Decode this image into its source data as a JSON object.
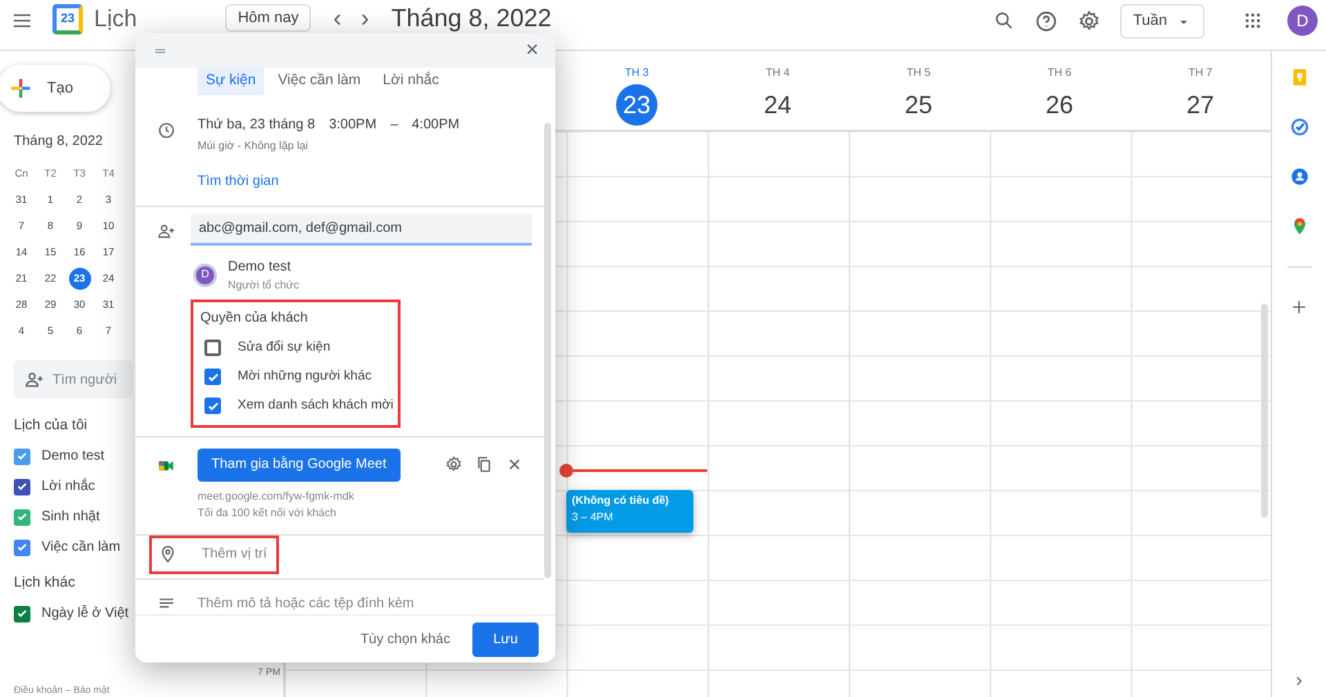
{
  "header": {
    "app_name": "Lịch",
    "logo_text": "23",
    "today_button": "Hôm nay",
    "prev": "‹",
    "next": "›",
    "title": "Tháng 8, 2022",
    "view": "Tuần",
    "avatar": "D"
  },
  "sidebar": {
    "create": "Tạo",
    "mini_calendar": {
      "title": "Tháng 8, 2022",
      "weekdays": [
        "Cn",
        "T2",
        "T3",
        "T4"
      ],
      "weeks": [
        [
          {
            "day": "31",
            "selected": false
          },
          {
            "day": "1",
            "selected": false
          },
          {
            "day": "2",
            "selected": false
          },
          {
            "day": "3",
            "selected": false
          }
        ],
        [
          {
            "day": "7",
            "selected": false
          },
          {
            "day": "8",
            "selected": false
          },
          {
            "day": "9",
            "selected": false
          },
          {
            "day": "10",
            "selected": false
          }
        ],
        [
          {
            "day": "14",
            "selected": false
          },
          {
            "day": "15",
            "selected": false
          },
          {
            "day": "16",
            "selected": false
          },
          {
            "day": "17",
            "selected": false
          }
        ],
        [
          {
            "day": "21",
            "selected": false
          },
          {
            "day": "22",
            "selected": false
          },
          {
            "day": "23",
            "selected": true
          },
          {
            "day": "24",
            "selected": false
          }
        ],
        [
          {
            "day": "28",
            "selected": false
          },
          {
            "day": "29",
            "selected": false
          },
          {
            "day": "30",
            "selected": false
          },
          {
            "day": "31",
            "selected": false
          }
        ],
        [
          {
            "day": "4",
            "selected": false
          },
          {
            "day": "5",
            "selected": false
          },
          {
            "day": "6",
            "selected": false
          },
          {
            "day": "7",
            "selected": false
          }
        ]
      ]
    },
    "search_placeholder": "Tìm người",
    "sections": [
      {
        "title": "Lịch của tôi",
        "items": [
          {
            "label": "Demo test",
            "checked": true,
            "color": "#4a9cf0"
          },
          {
            "label": "Lời nhắc",
            "checked": true,
            "color": "#3f51b5"
          },
          {
            "label": "Sinh nhật",
            "checked": true,
            "color": "#33b679"
          },
          {
            "label": "Việc cần làm",
            "checked": true,
            "color": "#4285f4"
          }
        ]
      },
      {
        "title": "Lịch khác",
        "items": [
          {
            "label": "Ngày lễ ở Việt",
            "checked": true,
            "color": "#0b8043"
          }
        ]
      }
    ],
    "footer": "Điều khoản – Bảo mật"
  },
  "week": {
    "days": [
      {
        "weekday": "TH 3",
        "date": "23",
        "selected": true,
        "events": [
          {
            "title": "(Không có tiêu đề)",
            "time": "3 – 4PM"
          }
        ]
      },
      {
        "weekday": "TH 4",
        "date": "24",
        "selected": false
      },
      {
        "weekday": "TH 5",
        "date": "25",
        "selected": false
      },
      {
        "weekday": "TH 6",
        "date": "26",
        "selected": false
      },
      {
        "weekday": "TH 7",
        "date": "27",
        "selected": false
      }
    ],
    "hour_label": "7 PM"
  },
  "dialog": {
    "close": "×",
    "tabs": [
      {
        "label": "Sự kiện",
        "selected": true
      },
      {
        "label": "Việc cần làm",
        "selected": false
      },
      {
        "label": "Lời nhắc",
        "selected": false
      }
    ],
    "date": "Thứ ba, 23 tháng 8",
    "start": "3:00PM",
    "dash": "–",
    "end": "4:00PM",
    "recurrence": "Múi giờ - Không lặp lại",
    "find_time": "Tìm thời gian",
    "guests_value": "abc@gmail.com, def@gmail.com",
    "organizer": {
      "avatar": "D",
      "name": "Demo test",
      "role": "Người tổ chức"
    },
    "guest_permissions": {
      "highlighted": true,
      "title": "Quyền của khách",
      "options": [
        {
          "label": "Sửa đổi sự kiện",
          "checked": false
        },
        {
          "label": "Mời những người khác",
          "checked": true
        },
        {
          "label": "Xem danh sách khách mời",
          "checked": true
        }
      ]
    },
    "meet": {
      "button": "Tham gia bằng Google Meet",
      "link": "meet.google.com/fyw-fgmk-mdk",
      "note": "Tối đa 100 kết nối với khách"
    },
    "location": {
      "highlighted": true,
      "placeholder": "Thêm vị trí"
    },
    "description_placeholder": "Thêm mô tả hoặc các tệp đính kèm",
    "more_options": "Tùy chọn khác",
    "save": "Lưu"
  }
}
